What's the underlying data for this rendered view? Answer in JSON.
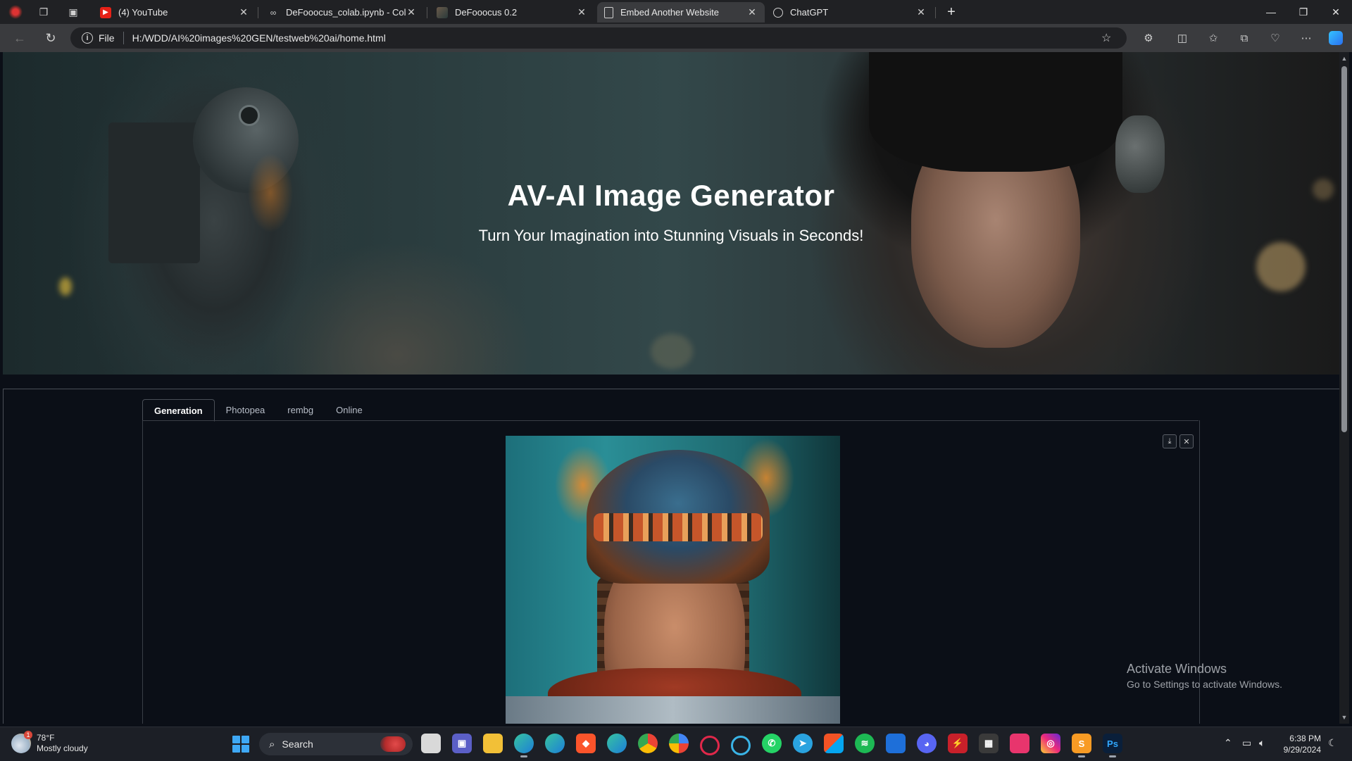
{
  "browser": {
    "tabs": [
      {
        "title": "(4) YouTube",
        "icon": "youtube-icon",
        "active": false
      },
      {
        "title": "DeFooocus_colab.ipynb - Colab",
        "icon": "colab-icon",
        "active": false
      },
      {
        "title": "DeFooocus 0.2",
        "icon": "site-thumbnail-icon",
        "active": false
      },
      {
        "title": "Embed Another Website",
        "icon": "page-icon",
        "active": true
      },
      {
        "title": "ChatGPT",
        "icon": "chatgpt-icon",
        "active": false
      }
    ],
    "address": {
      "scheme": "File",
      "url": "H:/WDD/AI%20images%20GEN/testweb%20ai/home.html"
    }
  },
  "page": {
    "hero": {
      "title": "AV-AI Image Generator",
      "subtitle": "Turn Your Imagination into Stunning Visuals in Seconds!"
    },
    "app_tabs": [
      "Generation",
      "Photopea",
      "rembg",
      "Online"
    ],
    "active_app_tab": "Generation"
  },
  "watermark": {
    "line1": "Activate Windows",
    "line2": "Go to Settings to activate Windows."
  },
  "taskbar": {
    "weather": {
      "temp": "78°F",
      "condition": "Mostly cloudy",
      "badge": "1"
    },
    "search_label": "Search",
    "time": "6:38 PM",
    "date": "9/29/2024"
  },
  "colors": {
    "accent": "#3ea8f5",
    "page_bg": "#0b0f17",
    "chrome_bg": "#202124",
    "toolbar_bg": "#3a3b3e"
  }
}
